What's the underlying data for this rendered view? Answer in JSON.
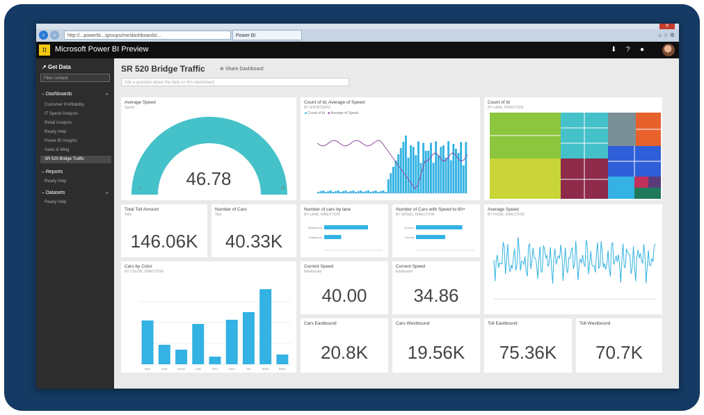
{
  "browser": {
    "address": "http://...powerbi.../groups/me/dashboards/...",
    "tab_label": "Power BI"
  },
  "app": {
    "logo": "",
    "title": "Microsoft Power BI Preview",
    "icons": [
      "download-icon",
      "help-icon",
      "settings-icon"
    ]
  },
  "sidebar": {
    "get_data": "Get Data",
    "search_placeholder": "Filter content",
    "sections": {
      "dashboards": "Dashboards",
      "reports": "Reports",
      "datasets": "Datasets"
    },
    "dashboard_items": [
      "Customer Profitability",
      "IT Spend Analysis",
      "Retail Analysis",
      "Ready Help",
      "Power BI Insights",
      "Sales & Mktg",
      "SR 520 Bridge Traffic"
    ],
    "report_items": [
      "Ready Help"
    ],
    "dataset_items": [
      "Ready Help"
    ]
  },
  "header": {
    "title": "SR 520 Bridge Traffic",
    "share": "Share Dashboard",
    "qa_placeholder": "Ask a question about the data on this dashboard"
  },
  "tiles": {
    "average_speed": {
      "title": "Average Speed",
      "sub": "Speed",
      "value": "46.78",
      "min": "0",
      "max": "60",
      "fraction": 1.0
    },
    "count_vs_speed": {
      "title": "Count of Id, Average of Speed",
      "sub": "BY SHORTDATE",
      "legend": [
        "Count of Id",
        "Average of Speed"
      ]
    },
    "count_treemap": {
      "title": "Count of Id",
      "sub": "BY LANE, DIRECTION"
    },
    "total_toll": {
      "title": "Total Toll Amount",
      "sub": "Tolls",
      "value": "146.06K"
    },
    "num_cars": {
      "title": "Number of Cars",
      "sub": "Tolls",
      "value": "40.33K"
    },
    "cars_by_lane": {
      "title": "Number of cars by lane",
      "sub": "BY LANE, DIRECTION",
      "labels": [
        "Westbound",
        "Eastbound"
      ]
    },
    "cars_speed_gt": {
      "title": "Number of Cars with Speed to 60+",
      "sub": "BY SPEED, DIRECTION",
      "labels": [
        "Exceed",
        "Normal"
      ]
    },
    "avg_speed_line": {
      "title": "Average Speed",
      "sub": "BY HOUR, DIRECTION"
    },
    "cars_by_color": {
      "title": "Cars by Color",
      "sub": "BY COLOR, DIRECTION"
    },
    "current_speed_1": {
      "title": "Current Speed",
      "sub": "Westbound",
      "value": "40.00"
    },
    "current_speed_2": {
      "title": "Current Speed",
      "sub": "Eastbound",
      "value": "34.86"
    },
    "cars_eastbound": {
      "title": "Cars Eastbound",
      "value": "20.8K"
    },
    "cars_westbound": {
      "title": "Cars Westbound",
      "value": "19.56K"
    },
    "toll_eastbound": {
      "title": "Toll Eastbound",
      "value": "75.36K"
    },
    "toll_westbound": {
      "title": "Toll Westbound",
      "value": "70.7K"
    }
  },
  "colors": {
    "accent": "#45c1c9",
    "bar": "#33b2e3",
    "line": "#8d4b9c",
    "frame": "#153a63"
  },
  "chart_data": [
    {
      "type": "bar",
      "categories": [
        "Blue",
        "Gray",
        "Green",
        "Gray",
        "Red",
        "Silver",
        "Tan",
        "White",
        "Black"
      ],
      "values": [
        63,
        28,
        21,
        58,
        11,
        64,
        75,
        108,
        14
      ],
      "ylim": [
        0,
        120
      ]
    },
    {
      "type": "bar",
      "categories": [
        "Westbound",
        "Eastbound"
      ],
      "values": [
        180,
        70
      ],
      "xlim": [
        0,
        240
      ]
    },
    {
      "type": "bar",
      "categories": [
        "Exceed",
        "Normal"
      ],
      "values": [
        190,
        120
      ],
      "xlim": [
        0,
        240
      ]
    }
  ]
}
